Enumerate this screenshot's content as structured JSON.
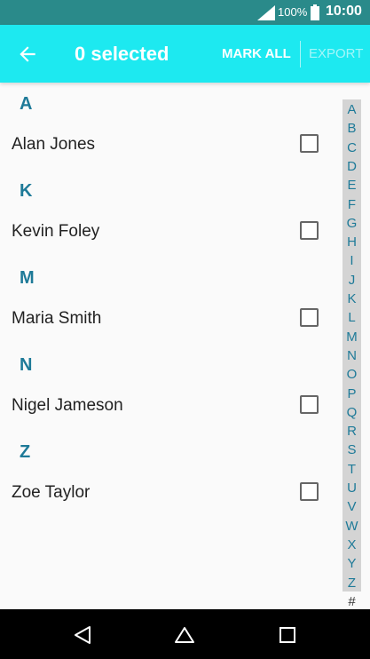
{
  "status_bar": {
    "battery_percent": "100%",
    "time": "10:00"
  },
  "app_bar": {
    "title": "0 selected",
    "mark_all_label": "MARK ALL",
    "export_label": "EXPORT"
  },
  "sections": [
    {
      "letter": "A",
      "contacts": [
        {
          "name": "Alan Jones",
          "checked": false
        }
      ]
    },
    {
      "letter": "K",
      "contacts": [
        {
          "name": "Kevin Foley",
          "checked": false
        }
      ]
    },
    {
      "letter": "M",
      "contacts": [
        {
          "name": "Maria Smith",
          "checked": false
        }
      ]
    },
    {
      "letter": "N",
      "contacts": [
        {
          "name": "Nigel Jameson",
          "checked": false
        }
      ]
    },
    {
      "letter": "Z",
      "contacts": [
        {
          "name": "Zoe Taylor",
          "checked": false
        }
      ]
    }
  ],
  "index_letters": [
    "A",
    "B",
    "C",
    "D",
    "E",
    "F",
    "G",
    "H",
    "I",
    "J",
    "K",
    "L",
    "M",
    "N",
    "O",
    "P",
    "Q",
    "R",
    "S",
    "T",
    "U",
    "V",
    "W",
    "X",
    "Y",
    "Z",
    "#"
  ],
  "colors": {
    "status_bar": "#2a8a8a",
    "app_bar": "#1de9f0",
    "accent_text": "#1e7a98",
    "nav_bar": "#000000"
  },
  "nav_bar": {
    "icons": [
      "back-icon",
      "home-icon",
      "recents-icon"
    ]
  }
}
